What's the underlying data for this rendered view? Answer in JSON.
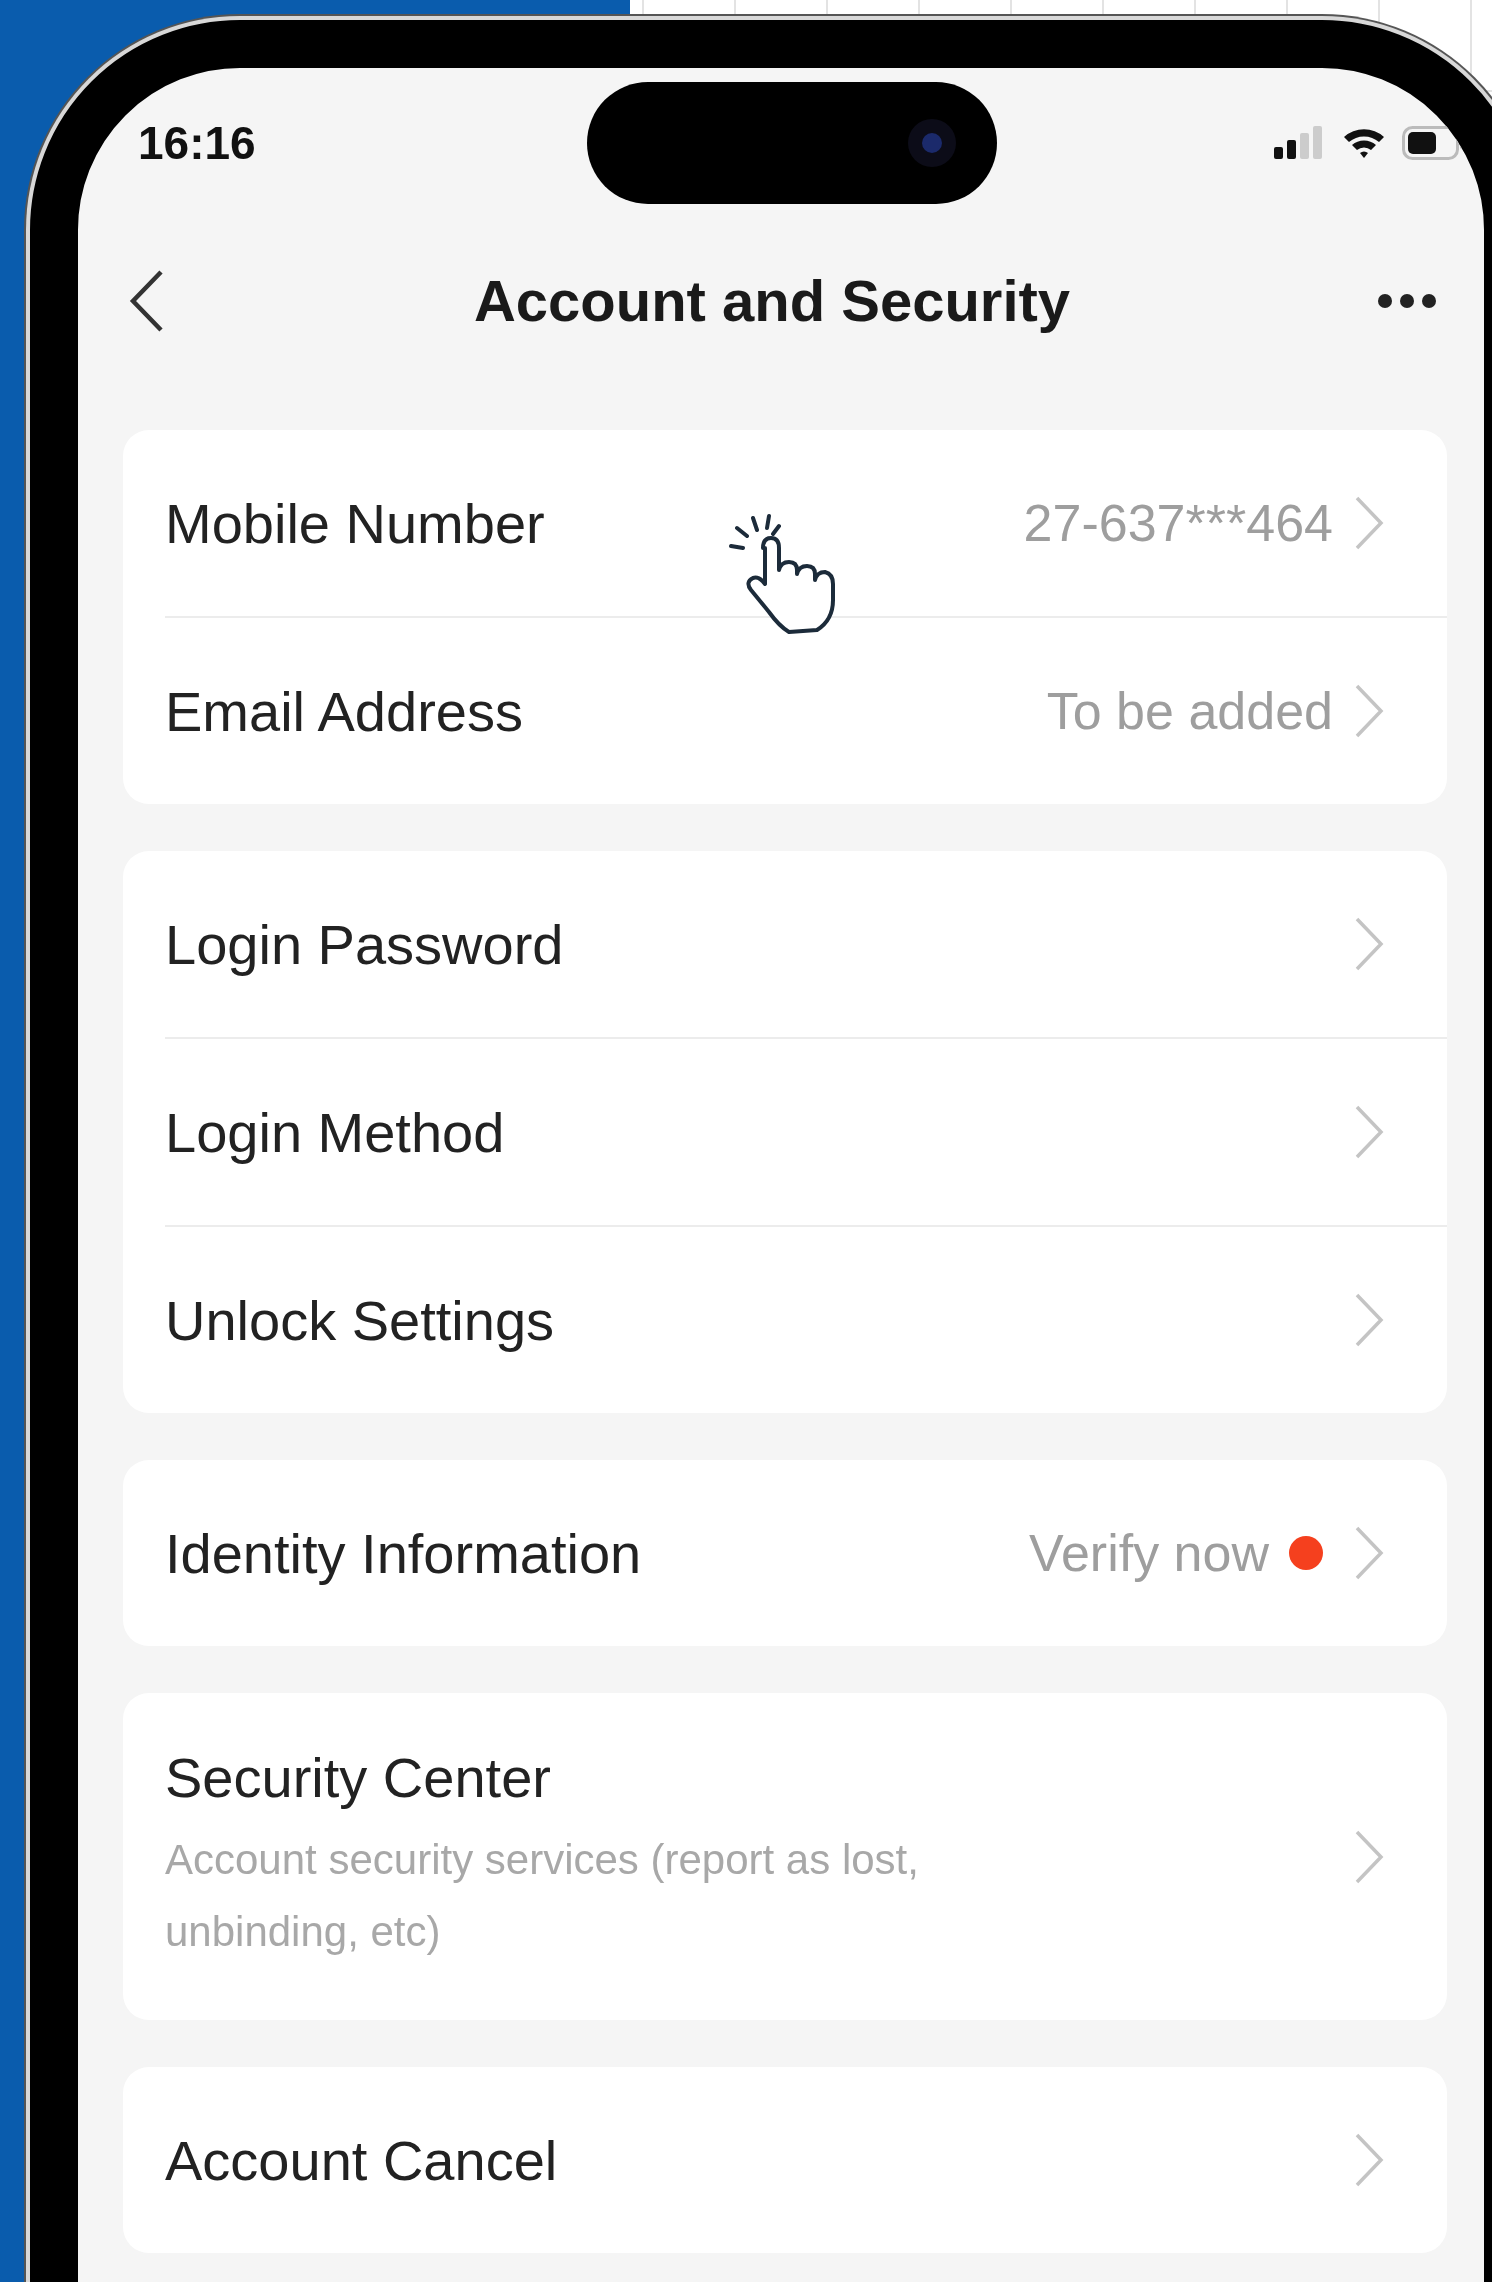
{
  "status_bar": {
    "time": "16:16"
  },
  "nav": {
    "title": "Account and Security"
  },
  "groups": [
    {
      "rows": [
        {
          "label": "Mobile Number",
          "value": "27-637***464"
        },
        {
          "label": "Email Address",
          "value": "To be added"
        }
      ]
    },
    {
      "rows": [
        {
          "label": "Login Password"
        },
        {
          "label": "Login Method"
        },
        {
          "label": "Unlock Settings"
        }
      ]
    },
    {
      "rows": [
        {
          "label": "Identity Information",
          "value": "Verify now",
          "color": "#f5401e"
        }
      ]
    },
    {
      "rows": [
        {
          "label": "Security Center",
          "subtitle": "Account security services (report as lost, unbinding, etc)"
        }
      ]
    },
    {
      "rows": [
        {
          "label": "Account Cancel"
        }
      ]
    }
  ]
}
